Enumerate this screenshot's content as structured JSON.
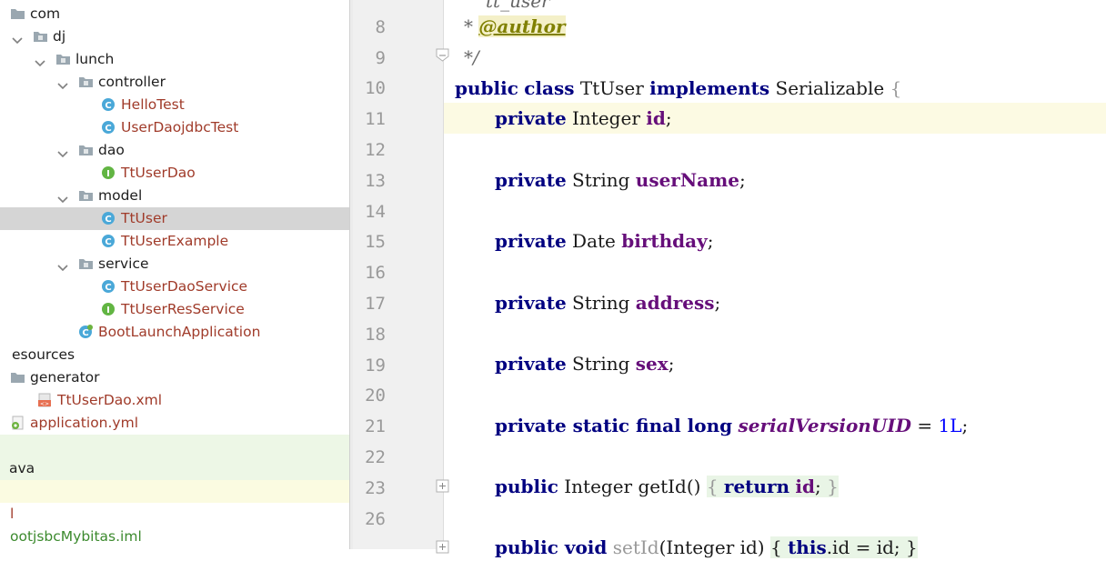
{
  "project_tree": {
    "rows": [
      {
        "label": "com",
        "icon": "folder-icon",
        "arrow": "none",
        "color": "dark"
      },
      {
        "label": "dj",
        "icon": "package-icon",
        "arrow": "expanded",
        "color": "dark"
      },
      {
        "label": "lunch",
        "icon": "package-icon",
        "arrow": "expanded",
        "color": "dark"
      },
      {
        "label": "controller",
        "icon": "package-icon",
        "arrow": "expanded",
        "color": "dark"
      },
      {
        "label": "HelloTest",
        "icon": "class-icon",
        "arrow": "none",
        "color": "red"
      },
      {
        "label": "UserDaojdbcTest",
        "icon": "class-icon",
        "arrow": "none",
        "color": "red"
      },
      {
        "label": "dao",
        "icon": "package-icon",
        "arrow": "expanded",
        "color": "dark"
      },
      {
        "label": "TtUserDao",
        "icon": "interface-icon",
        "arrow": "none",
        "color": "red"
      },
      {
        "label": "model",
        "icon": "package-icon",
        "arrow": "expanded",
        "color": "dark"
      },
      {
        "label": "TtUser",
        "icon": "class-icon",
        "arrow": "none",
        "color": "red"
      },
      {
        "label": "TtUserExample",
        "icon": "class-icon",
        "arrow": "none",
        "color": "red"
      },
      {
        "label": "service",
        "icon": "package-icon",
        "arrow": "expanded",
        "color": "dark"
      },
      {
        "label": "TtUserDaoService",
        "icon": "class-icon",
        "arrow": "none",
        "color": "red"
      },
      {
        "label": "TtUserResService",
        "icon": "interface-icon",
        "arrow": "none",
        "color": "red"
      },
      {
        "label": "BootLaunchApplication",
        "icon": "spring-class-icon",
        "arrow": "none",
        "color": "red"
      },
      {
        "label": "esources",
        "icon": "none",
        "arrow": "none",
        "color": "dark"
      },
      {
        "label": "generator",
        "icon": "folder-icon",
        "arrow": "none",
        "color": "dark"
      },
      {
        "label": "TtUserDao.xml",
        "icon": "xml-file-icon",
        "arrow": "none",
        "color": "red"
      },
      {
        "label": "application.yml",
        "icon": "yml-file-icon",
        "arrow": "none",
        "color": "red"
      },
      {
        "label": "",
        "icon": "none",
        "arrow": "none",
        "color": "dark"
      },
      {
        "label": "ava",
        "icon": "none",
        "arrow": "none",
        "color": "dark"
      },
      {
        "label": "",
        "icon": "none",
        "arrow": "none",
        "color": "dark"
      },
      {
        "label": "l",
        "icon": "none",
        "arrow": "none",
        "color": "red"
      },
      {
        "label": "ootjsbcMybitas.iml",
        "icon": "none",
        "arrow": "none",
        "color": "green"
      }
    ]
  },
  "editor": {
    "line_numbers": [
      "",
      "8",
      "9",
      "10",
      "11",
      "12",
      "13",
      "14",
      "15",
      "16",
      "17",
      "18",
      "19",
      "20",
      "21",
      "22",
      "23",
      "26",
      ""
    ],
    "top_partial_text": "tt_user",
    "author_tag": "@author",
    "comment_star": "* ",
    "comment_end": "*/",
    "class_decl": {
      "kw1": "public",
      "kw2": "class",
      "name": "TtUser",
      "kw3": "implements",
      "iface": "Serializable",
      "brace": "{"
    },
    "fields": [
      {
        "mod": "private",
        "type": "Integer",
        "name": "id"
      },
      {
        "mod": "private",
        "type": "String",
        "name": "userName"
      },
      {
        "mod": "private",
        "type": "Date",
        "name": "birthday"
      },
      {
        "mod": "private",
        "type": "String",
        "name": "address"
      },
      {
        "mod": "private",
        "type": "String",
        "name": "sex"
      }
    ],
    "serial": {
      "mods": "private static final long",
      "name": "serialVersionUID",
      "eq": " = ",
      "value": "1L"
    },
    "getter": {
      "kw": "public",
      "type": "Integer",
      "name": "getId",
      "parens": "()",
      "ret": "return",
      "field": "id"
    },
    "setter_partial": {
      "kw": "public void",
      "name": "setId",
      "params": "(Integer id)",
      "body_kw": "this",
      "field": ".id = id;"
    }
  }
}
